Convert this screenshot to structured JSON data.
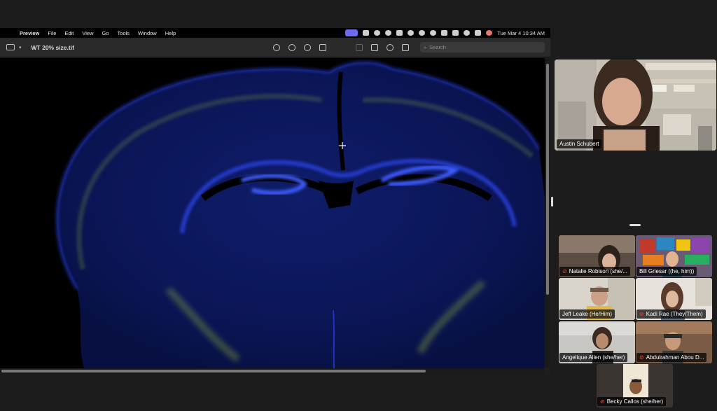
{
  "menubar": {
    "apple": "",
    "app_name": "Preview",
    "items": [
      "File",
      "Edit",
      "View",
      "Go",
      "Tools",
      "Window",
      "Help"
    ],
    "clock": "Tue Mar 4  10:34 AM"
  },
  "toolbar": {
    "document_title": "WT 20% size.tif",
    "search_placeholder": "Search"
  },
  "speaker": {
    "name": "Austin Schubert"
  },
  "participants": [
    {
      "name": "Natalie Robison (she/...",
      "muted": true
    },
    {
      "name": "Bill Griesar ((he, him))",
      "muted": false
    },
    {
      "name": "Jeff Leake (He/Him)",
      "muted": false
    },
    {
      "name": "Kadi Rae (They/Them)",
      "muted": true
    },
    {
      "name": "Angelique Allen (she/her)",
      "muted": false
    },
    {
      "name": "Abdulrahman Abou D...",
      "muted": true
    },
    {
      "name": "Becky Callos (she/her)",
      "muted": true
    }
  ],
  "colors": {
    "tissue_blue": "#1a2fd6",
    "stain_green": "#9fc43a",
    "mute_red": "#e24a3b"
  }
}
